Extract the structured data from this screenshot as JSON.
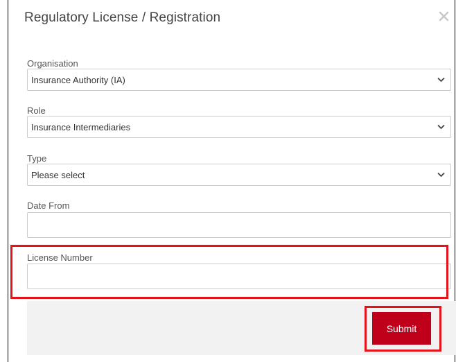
{
  "modal": {
    "title": "Regulatory License / Registration",
    "close_icon": "close-icon"
  },
  "form": {
    "organisation": {
      "label": "Organisation",
      "value": "Insurance Authority (IA)"
    },
    "role": {
      "label": "Role",
      "value": "Insurance Intermediaries"
    },
    "type": {
      "label": "Type",
      "value": "Please select"
    },
    "date_from": {
      "label": "Date From",
      "value": ""
    },
    "license_number": {
      "label": "License Number",
      "value": ""
    }
  },
  "footer": {
    "submit_label": "Submit"
  },
  "colors": {
    "highlight": "#e3131b",
    "submit_bg": "#c0001b",
    "footer_bg": "#f2f2f2"
  }
}
